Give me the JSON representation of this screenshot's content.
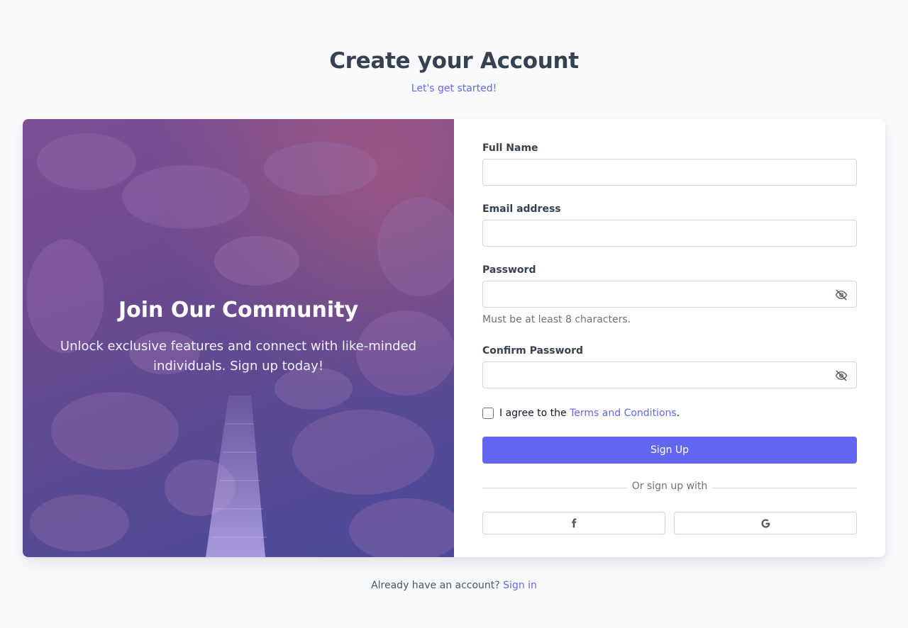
{
  "header": {
    "title": "Create your Account",
    "subtitle": "Let's get started!"
  },
  "hero": {
    "title": "Join Our Community",
    "description": "Unlock exclusive features and connect with like-minded individuals. Sign up today!"
  },
  "form": {
    "full_name": {
      "label": "Full Name",
      "value": "",
      "placeholder": ""
    },
    "email": {
      "label": "Email address",
      "value": "",
      "placeholder": ""
    },
    "password": {
      "label": "Password",
      "value": "",
      "placeholder": "",
      "helper": "Must be at least 8 characters."
    },
    "confirm_password": {
      "label": "Confirm Password",
      "value": "",
      "placeholder": ""
    },
    "agree": {
      "prefix": "I agree to the ",
      "link": "Terms and Conditions",
      "suffix": ".",
      "checked": false
    },
    "submit_label": "Sign Up",
    "divider_text": "Or sign up with",
    "social": [
      {
        "icon": "facebook-icon"
      },
      {
        "icon": "google-icon"
      }
    ]
  },
  "footer": {
    "prompt": "Already have an account? ",
    "link": "Sign in"
  },
  "colors": {
    "accent": "#6366f1",
    "background": "#f8fafc",
    "heading": "#364152"
  }
}
